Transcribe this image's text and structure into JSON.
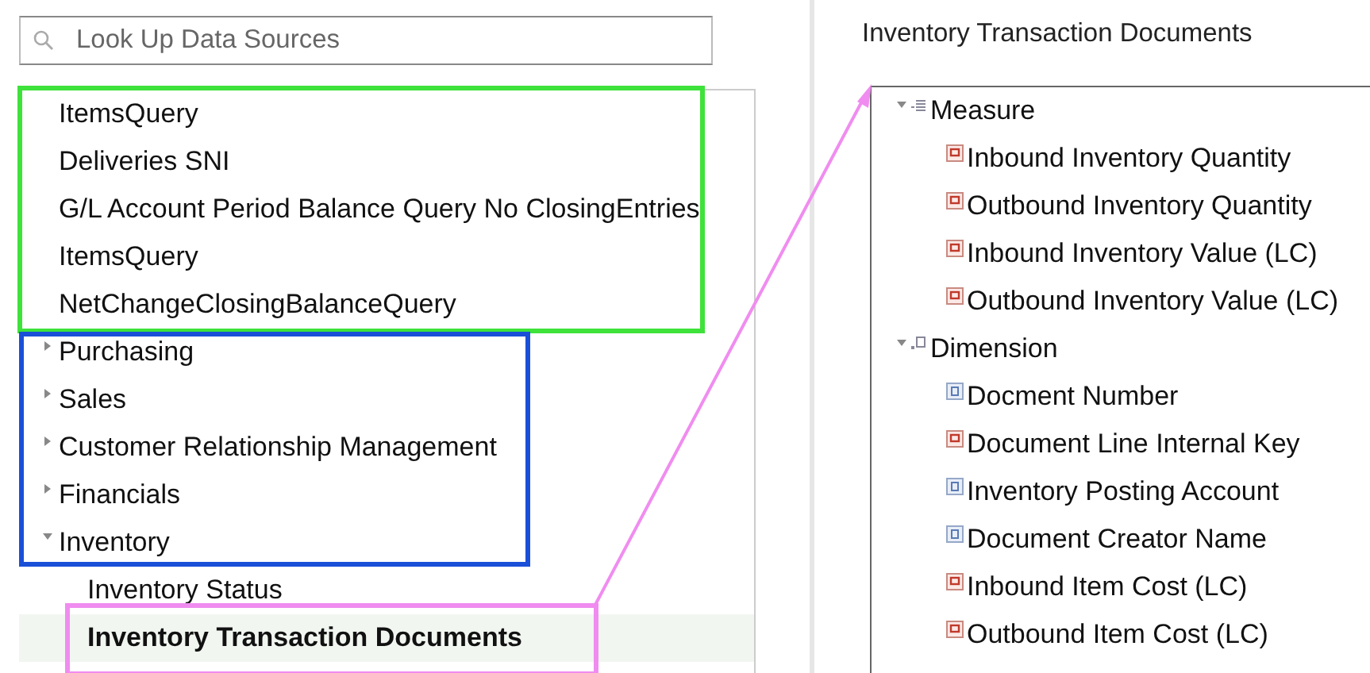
{
  "search": {
    "placeholder": "Look Up Data Sources"
  },
  "recent_queries": [
    {
      "label": "ItemsQuery"
    },
    {
      "label": "Deliveries SNI"
    },
    {
      "label": "G/L Account Period Balance Query No ClosingEntries"
    },
    {
      "label": "ItemsQuery"
    },
    {
      "label": "NetChangeClosingBalanceQuery"
    }
  ],
  "categories": [
    {
      "label": "Purchasing",
      "expanded": false
    },
    {
      "label": "Sales",
      "expanded": false
    },
    {
      "label": "Customer Relationship Management",
      "expanded": false
    },
    {
      "label": "Financials",
      "expanded": false
    },
    {
      "label": "Inventory",
      "expanded": true,
      "children": [
        {
          "label": "Inventory Status",
          "selected": false
        },
        {
          "label": "Inventory Transaction Documents",
          "selected": true
        }
      ]
    }
  ],
  "detail": {
    "title": "Inventory Transaction Documents",
    "groups": [
      {
        "label": "Measure",
        "kind": "measure",
        "expanded": true,
        "fields": [
          {
            "label": "Inbound Inventory Quantity",
            "kind": "numeric"
          },
          {
            "label": "Outbound Inventory Quantity",
            "kind": "numeric"
          },
          {
            "label": "Inbound Inventory Value (LC)",
            "kind": "numeric"
          },
          {
            "label": "Outbound Inventory Value (LC)",
            "kind": "numeric"
          }
        ]
      },
      {
        "label": "Dimension",
        "kind": "dimension",
        "expanded": true,
        "fields": [
          {
            "label": "Docment Number",
            "kind": "string"
          },
          {
            "label": "Document Line Internal Key",
            "kind": "numeric"
          },
          {
            "label": "Inventory Posting Account",
            "kind": "string"
          },
          {
            "label": "Document Creator Name",
            "kind": "string"
          },
          {
            "label": "Inbound Item Cost (LC)",
            "kind": "numeric"
          },
          {
            "label": "Outbound Item Cost (LC)",
            "kind": "numeric"
          }
        ]
      }
    ]
  }
}
